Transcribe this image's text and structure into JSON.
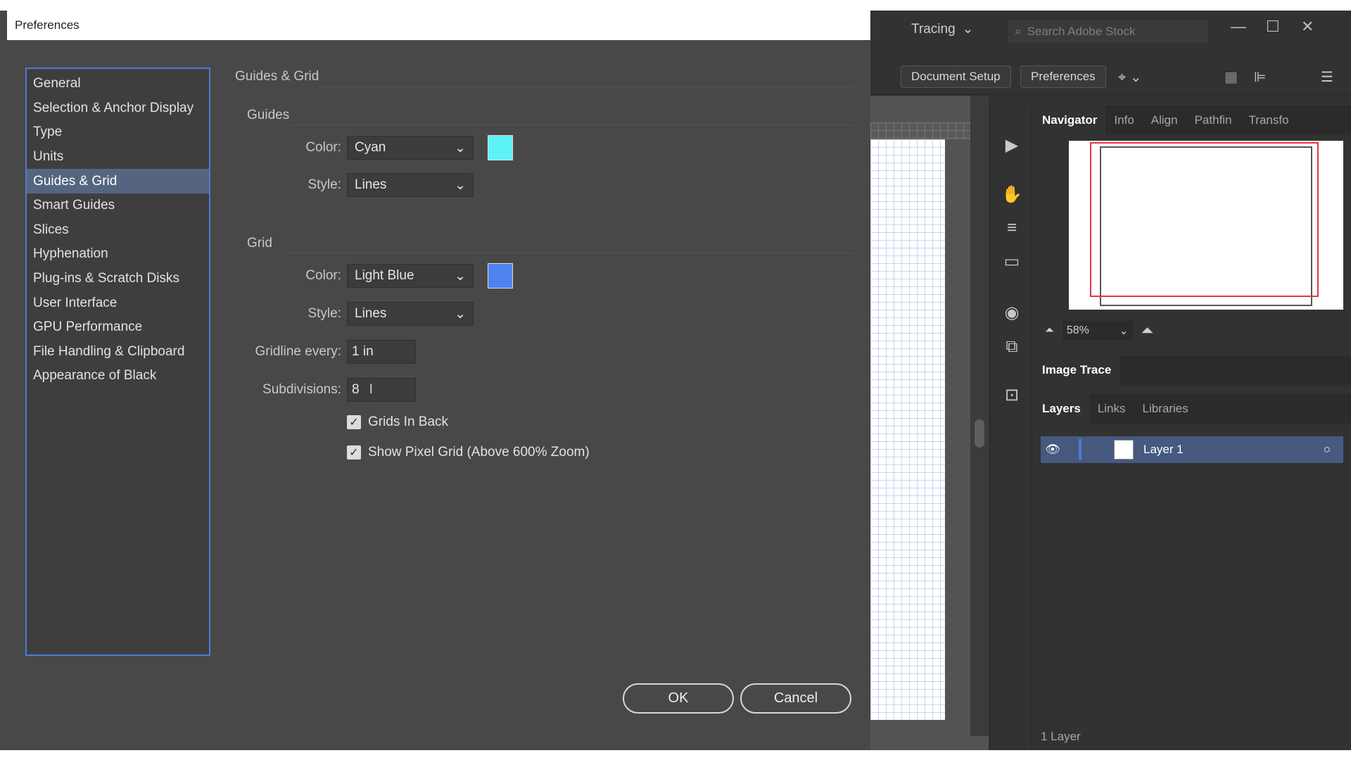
{
  "dialog": {
    "title": "Preferences",
    "categories": [
      "General",
      "Selection & Anchor Display",
      "Type",
      "Units",
      "Guides & Grid",
      "Smart Guides",
      "Slices",
      "Hyphenation",
      "Plug-ins & Scratch Disks",
      "User Interface",
      "GPU Performance",
      "File Handling & Clipboard",
      "Appearance of Black"
    ],
    "selected_category": "Guides & Grid",
    "panel_title": "Guides & Grid",
    "guides": {
      "heading": "Guides",
      "color_label": "Color:",
      "color_value": "Cyan",
      "color_hex": "#5ef1f6",
      "style_label": "Style:",
      "style_value": "Lines"
    },
    "grid": {
      "heading": "Grid",
      "color_label": "Color:",
      "color_value": "Light Blue",
      "color_hex": "#4f83f1",
      "style_label": "Style:",
      "style_value": "Lines",
      "gridline_label": "Gridline every:",
      "gridline_value": "1 in",
      "subdivisions_label": "Subdivisions:",
      "subdivisions_value": "8",
      "grids_in_back_label": "Grids In Back",
      "grids_in_back_checked": true,
      "pixel_grid_label": "Show Pixel Grid (Above 600% Zoom)",
      "pixel_grid_checked": true
    },
    "ok_label": "OK",
    "cancel_label": "Cancel"
  },
  "app": {
    "workspace": "Tracing",
    "search_placeholder": "Search Adobe Stock",
    "document_setup_label": "Document Setup",
    "preferences_label": "Preferences",
    "nav_tabs": [
      "Navigator",
      "Info",
      "Align",
      "Pathfin",
      "Transfo"
    ],
    "zoom_value": "58%",
    "image_trace_label": "Image Trace",
    "layer_tabs": [
      "Layers",
      "Links",
      "Libraries"
    ],
    "layer_name": "Layer 1",
    "layer_count": "1 Layer",
    "accent_color": "#4e7bd1",
    "selected_layer_color": "#46597e"
  }
}
